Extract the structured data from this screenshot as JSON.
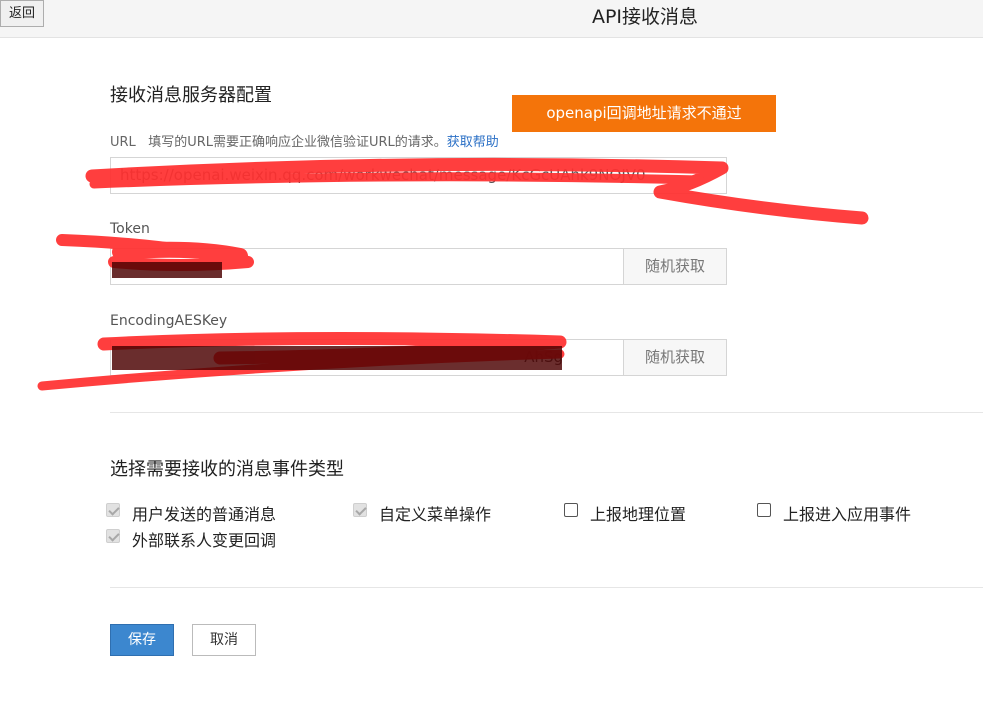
{
  "header": {
    "back_label": "返回",
    "title": "API接收消息"
  },
  "server_config": {
    "title": "接收消息服务器配置",
    "url_label": "URL",
    "url_hint": "填写的URL需要正确响应企业微信验证URL的请求。",
    "url_help": "获取帮助",
    "url_value": "https://openai.weixin.qq.com/workwechat/message/KcGcUAhk9NOJV0",
    "token_label": "Token",
    "token_value": "",
    "aes_label": "EncodingAESKey",
    "aes_value": "AhSg",
    "random_label": "随机获取",
    "alert": "openapi回调地址请求不通过"
  },
  "events": {
    "title": "选择需要接收的消息事件类型",
    "items": [
      {
        "label": "用户发送的普通消息",
        "checked": true
      },
      {
        "label": "自定义菜单操作",
        "checked": true
      },
      {
        "label": "上报地理位置",
        "checked": false
      },
      {
        "label": "上报进入应用事件",
        "checked": false
      },
      {
        "label": "外部联系人变更回调",
        "checked": true
      }
    ]
  },
  "actions": {
    "save_label": "保存",
    "cancel_label": "取消"
  },
  "colors": {
    "accent": "#3c87cf",
    "alert": "#f4740a",
    "redaction": "#ff3030"
  }
}
